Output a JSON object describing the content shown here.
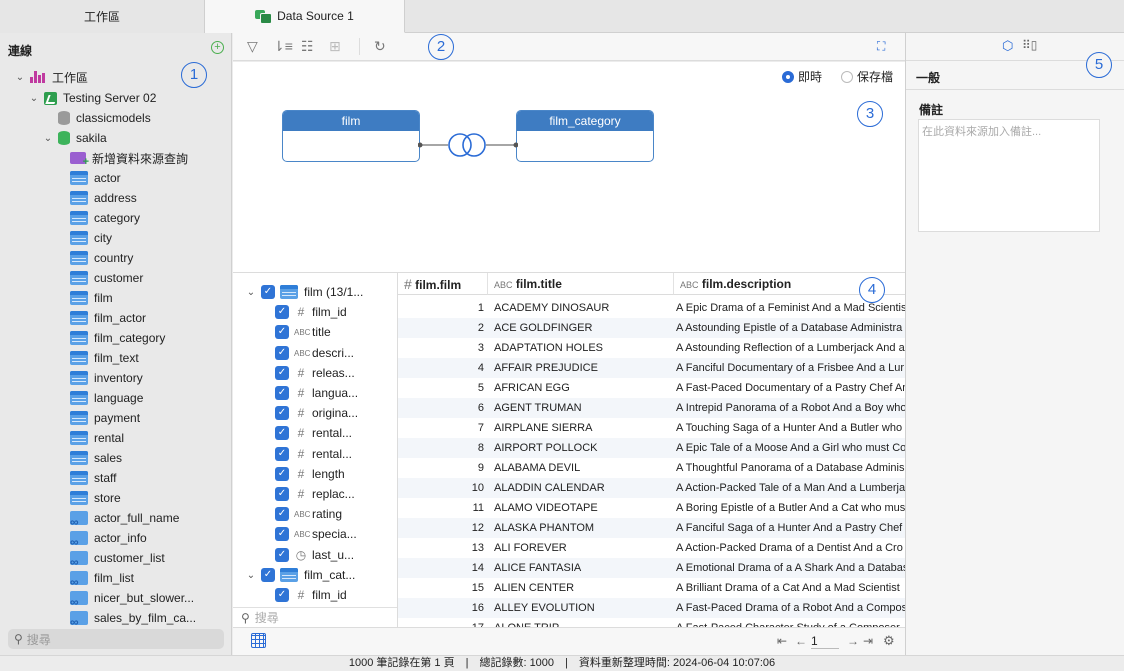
{
  "tabs": {
    "workspace": "工作區",
    "datasource": "Data Source 1"
  },
  "sidebar": {
    "title": "連線",
    "workspace": "工作區",
    "server": "Testing Server 02",
    "db1": "classicmodels",
    "db2": "sakila",
    "new_query": "新增資料來源查詢",
    "tables": [
      "actor",
      "address",
      "category",
      "city",
      "country",
      "customer",
      "film",
      "film_actor",
      "film_category",
      "film_text",
      "inventory",
      "language",
      "payment",
      "rental",
      "sales",
      "staff",
      "store"
    ],
    "views": [
      "actor_full_name",
      "actor_info",
      "customer_list",
      "film_list",
      "nicer_but_slower...",
      "sales_by_film_ca..."
    ],
    "search_placeholder": "搜尋"
  },
  "callouts": [
    "1",
    "2",
    "3",
    "4",
    "5"
  ],
  "canvas": {
    "mode_live": "即時",
    "mode_saved": "保存檔",
    "entity1": "film",
    "entity2": "film_category"
  },
  "fields": {
    "group1": "film (13/1...",
    "items": [
      {
        "type": "#",
        "name": "film_id"
      },
      {
        "type": "ABC",
        "name": "title"
      },
      {
        "type": "ABC",
        "name": "descri..."
      },
      {
        "type": "#",
        "name": "releas..."
      },
      {
        "type": "#",
        "name": "langua..."
      },
      {
        "type": "#",
        "name": "origina..."
      },
      {
        "type": "#",
        "name": "rental..."
      },
      {
        "type": "#",
        "name": "rental..."
      },
      {
        "type": "#",
        "name": "length"
      },
      {
        "type": "#",
        "name": "replac..."
      },
      {
        "type": "ABC",
        "name": "rating"
      },
      {
        "type": "ABC",
        "name": "specia..."
      },
      {
        "type": "clock",
        "name": "last_u..."
      }
    ],
    "group2": "film_cat...",
    "group2_items": [
      {
        "type": "#",
        "name": "film_id"
      }
    ],
    "search_placeholder": "搜尋"
  },
  "grid": {
    "columns": [
      "film.film",
      "film.title",
      "film.description"
    ],
    "rows": [
      [
        "1",
        "ACADEMY DINOSAUR",
        "A Epic Drama of a Feminist And a Mad Scientis"
      ],
      [
        "2",
        "ACE GOLDFINGER",
        "A Astounding Epistle of a Database Administra"
      ],
      [
        "3",
        "ADAPTATION HOLES",
        "A Astounding Reflection of a Lumberjack And a"
      ],
      [
        "4",
        "AFFAIR PREJUDICE",
        "A Fanciful Documentary of a Frisbee And a Lur"
      ],
      [
        "5",
        "AFRICAN EGG",
        "A Fast-Paced Documentary of a Pastry Chef An"
      ],
      [
        "6",
        "AGENT TRUMAN",
        "A Intrepid Panorama of a Robot And a Boy who"
      ],
      [
        "7",
        "AIRPLANE SIERRA",
        "A Touching Saga of a Hunter And a Butler who"
      ],
      [
        "8",
        "AIRPORT POLLOCK",
        "A Epic Tale of a Moose And a Girl who must Co"
      ],
      [
        "9",
        "ALABAMA DEVIL",
        "A Thoughtful Panorama of a Database Adminis"
      ],
      [
        "10",
        "ALADDIN CALENDAR",
        "A Action-Packed Tale of a Man And a Lumberja"
      ],
      [
        "11",
        "ALAMO VIDEOTAPE",
        "A Boring Epistle of a Butler And a Cat who mus"
      ],
      [
        "12",
        "ALASKA PHANTOM",
        "A Fanciful Saga of a Hunter And a Pastry Chef"
      ],
      [
        "13",
        "ALI FOREVER",
        "A Action-Packed Drama of a Dentist And a Cro"
      ],
      [
        "14",
        "ALICE FANTASIA",
        "A Emotional Drama of a A Shark And a Databas"
      ],
      [
        "15",
        "ALIEN CENTER",
        "A Brilliant Drama of a Cat And a Mad Scientist"
      ],
      [
        "16",
        "ALLEY EVOLUTION",
        "A Fast-Paced Drama of a Robot And a Compos"
      ],
      [
        "17",
        "ALONE TRIP",
        "A Fast-Paced Character Study of a Composer"
      ]
    ]
  },
  "pager": {
    "page": "1"
  },
  "rightpanel": {
    "section": "一般",
    "notes_label": "備註",
    "notes_placeholder": "在此資料來源加入備註..."
  },
  "status": {
    "text": "1000 筆記錄在第 1 頁　|　總記錄數: 1000　|　資料重新整理時間: 2024-06-04 10:07:06"
  }
}
